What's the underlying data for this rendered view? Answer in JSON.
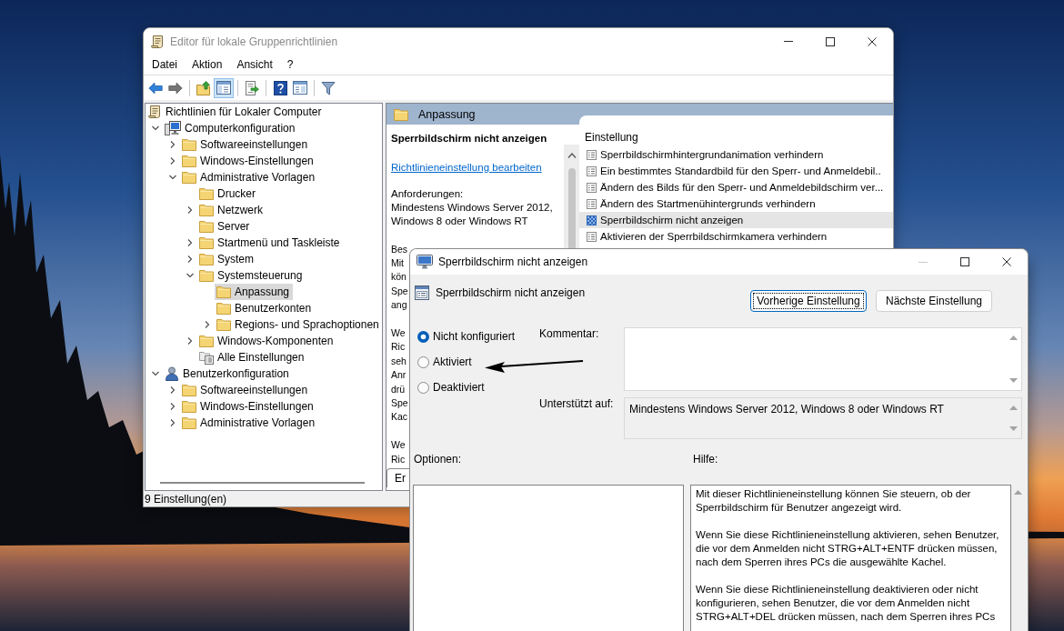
{
  "main_window": {
    "title": "Editor für lokale Gruppenrichtlinien",
    "active": false,
    "controls": [
      {
        "kind": "minimize",
        "disabled": false
      },
      {
        "kind": "maximize",
        "disabled": false
      },
      {
        "kind": "close",
        "disabled": false
      }
    ],
    "menu": [
      "Datei",
      "Aktion",
      "Ansicht",
      "?"
    ],
    "toolbar": [
      {
        "kind": "back",
        "on": false,
        "disabled": false
      },
      {
        "kind": "forward",
        "on": false,
        "disabled": true
      },
      {
        "kind": "separator"
      },
      {
        "kind": "up",
        "on": false,
        "disabled": false
      },
      {
        "kind": "tree",
        "on": true,
        "disabled": false
      },
      {
        "kind": "separator"
      },
      {
        "kind": "export",
        "on": false,
        "disabled": false
      },
      {
        "kind": "separator"
      },
      {
        "kind": "help",
        "on": false,
        "disabled": false
      },
      {
        "kind": "properties",
        "on": false,
        "disabled": false
      },
      {
        "kind": "separator"
      },
      {
        "kind": "filter",
        "on": false,
        "disabled": false
      }
    ],
    "tree": [
      {
        "label": "Richtlinien für Lokaler Computer",
        "kind": "root",
        "selected": false,
        "children": [
          {
            "label": "Computerkonfiguration",
            "kind": "computer",
            "expanded": true,
            "selected": false,
            "children": [
              {
                "label": "Softwareeinstellungen",
                "kind": "folder",
                "expanded": false,
                "selected": false
              },
              {
                "label": "Windows-Einstellungen",
                "kind": "folder",
                "expanded": false,
                "selected": false
              },
              {
                "label": "Administrative Vorlagen",
                "kind": "folder",
                "expanded": true,
                "selected": false,
                "children": [
                  {
                    "label": "Drucker",
                    "kind": "folder",
                    "selected": false
                  },
                  {
                    "label": "Netzwerk",
                    "kind": "folder",
                    "expanded": false,
                    "selected": false
                  },
                  {
                    "label": "Server",
                    "kind": "folder",
                    "selected": false
                  },
                  {
                    "label": "Startmenü und Taskleiste",
                    "kind": "folder",
                    "expanded": false,
                    "selected": false
                  },
                  {
                    "label": "System",
                    "kind": "folder",
                    "expanded": false,
                    "selected": false
                  },
                  {
                    "label": "Systemsteuerung",
                    "kind": "folder",
                    "expanded": true,
                    "selected": false,
                    "children": [
                      {
                        "label": "Anpassung",
                        "kind": "folder",
                        "selected": true
                      },
                      {
                        "label": "Benutzerkonten",
                        "kind": "folder",
                        "selected": false
                      },
                      {
                        "label": "Regions- und Sprachoptionen",
                        "kind": "folder",
                        "expanded": false,
                        "selected": false
                      }
                    ]
                  },
                  {
                    "label": "Windows-Komponenten",
                    "kind": "folder",
                    "expanded": false,
                    "selected": false
                  },
                  {
                    "label": "Alle Einstellungen",
                    "kind": "settings",
                    "selected": false
                  }
                ]
              }
            ]
          },
          {
            "label": "Benutzerkonfiguration",
            "kind": "user",
            "expanded": true,
            "selected": false,
            "children": [
              {
                "label": "Softwareeinstellungen",
                "kind": "folder",
                "expanded": false,
                "selected": false
              },
              {
                "label": "Windows-Einstellungen",
                "kind": "folder",
                "expanded": false,
                "selected": false
              },
              {
                "label": "Administrative Vorlagen",
                "kind": "folder",
                "expanded": false,
                "selected": false
              }
            ]
          }
        ]
      }
    ],
    "details": {
      "header": "Anpassung",
      "title": "Sperrbildschirm nicht anzeigen",
      "link": "Richtlinieneinstellung bearbeiten",
      "requirements_label": "Anforderungen:",
      "requirements": "Mindestens Windows Server 2012, Windows 8 oder Windows RT",
      "covered_text": [
        [
          "Bes",
          "Mit",
          "kön",
          "Spe",
          "ang"
        ],
        [
          "We",
          "Ric",
          "seh",
          "Anr",
          "drü",
          "Spe",
          "Kac"
        ],
        [
          "We",
          "Ric"
        ]
      ],
      "tabs": [
        {
          "label": "Er",
          "selected": true
        }
      ]
    },
    "list": {
      "column": "Einstellung",
      "rows": [
        {
          "label": "Sperrbildschirmhintergrundanimation verhindern",
          "selected": false
        },
        {
          "label": "Ein bestimmtes Standardbild für den Sperr- und Anmeldebil..",
          "selected": false
        },
        {
          "label": "Ändern des Bilds für den Sperr- und Anmeldebildschirm ver...",
          "selected": false
        },
        {
          "label": "Ändern des Startmenühintergrunds verhindern",
          "selected": false
        },
        {
          "label": "Sperrbildschirm nicht anzeigen",
          "selected": true
        },
        {
          "label": "Aktivieren der Sperrbildschirmkamera verhindern",
          "selected": false
        }
      ]
    },
    "status_bar": "9 Einstellung(en)"
  },
  "dialog": {
    "title": "Sperrbildschirm nicht anzeigen",
    "active": true,
    "controls": [
      {
        "kind": "minimize",
        "disabled": true
      },
      {
        "kind": "maximize",
        "disabled": false
      },
      {
        "kind": "close",
        "disabled": false
      }
    ],
    "policy_name": "Sperrbildschirm nicht anzeigen",
    "buttons": [
      {
        "label": "Vorherige Einstellung",
        "focused": true
      },
      {
        "label": "Nächste Einstellung",
        "focused": false
      }
    ],
    "options": [
      {
        "label": "Nicht konfiguriert",
        "selected": true
      },
      {
        "label": "Aktiviert",
        "selected": false
      },
      {
        "label": "Deaktiviert",
        "selected": false
      }
    ],
    "comment_label": "Kommentar:",
    "supported_label": "Unterstützt auf:",
    "supported_value": "Mindestens Windows Server 2012, Windows 8 oder Windows RT",
    "options_label": "Optionen:",
    "help_label": "Hilfe:",
    "help": [
      [
        "Mit dieser Richtlinieneinstellung können Sie steuern, ob der",
        "Sperrbildschirm für Benutzer angezeigt wird."
      ],
      [
        "Wenn Sie diese Richtlinieneinstellung aktivieren, sehen Benutzer,",
        "die vor dem Anmelden nicht STRG+ALT+ENTF drücken müssen,",
        "nach dem Sperren ihres PCs die ausgewählte Kachel."
      ],
      [
        "Wenn Sie diese Richtlinieneinstellung deaktivieren oder nicht",
        "konfigurieren, sehen Benutzer, die vor dem Anmelden nicht",
        "STRG+ALT+DEL drücken müssen, nach dem Sperren ihres PCs"
      ]
    ]
  }
}
